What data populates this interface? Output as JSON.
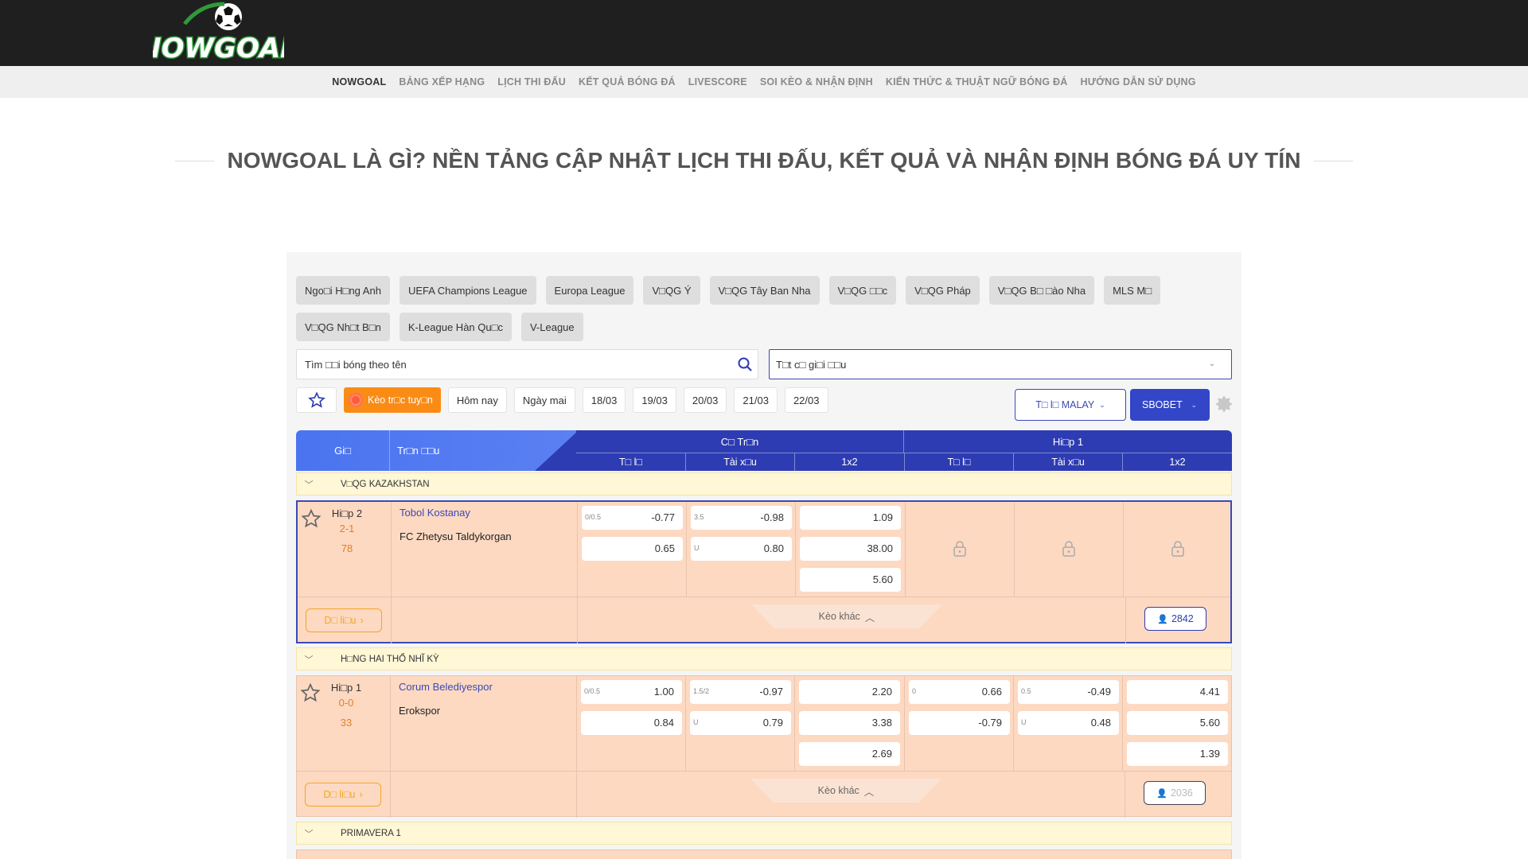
{
  "brand": {
    "logo_text": "NOWGOAL"
  },
  "nav": {
    "items": [
      "NOWGOAL",
      "BẢNG XẾP HẠNG",
      "LỊCH THI ĐẤU",
      "KẾT QUẢ BÓNG ĐÁ",
      "LIVESCORE",
      "SOI KÈO & NHẬN ĐỊNH",
      "KIẾN THỨC & THUẬT NGỮ BÓNG ĐÁ",
      "HƯỚNG DẪN SỬ DỤNG"
    ],
    "active_index": 0
  },
  "page_title": "NOWGOAL LÀ GÌ? NỀN TẢNG CẬP NHẬT LỊCH THI ĐẤU, KẾT QUẢ VÀ NHẬN ĐỊNH BÓNG ĐÁ UY TÍN",
  "leagues_chips": {
    "row1": [
      "Ngo□i H□ng Anh",
      "UEFA Champions League",
      "Europa League",
      "V□QG Ý",
      "V□QG Tây Ban Nha",
      "V□QG □□c",
      "V□QG Pháp",
      "V□QG B□ □ào Nha",
      "MLS M□"
    ],
    "row2": [
      "V□QG Nh□t B□n",
      "K-League Hàn Qu□c",
      "V-League"
    ]
  },
  "search": {
    "placeholder": "Tìm □□i bóng theo tên"
  },
  "league_select": {
    "value": "T□t c□ gi□i □□u"
  },
  "filters": {
    "live_label": "Kèo tr□c tuy□n",
    "today": "Hôm nay",
    "tomorrow": "Ngày mai",
    "dates": [
      "18/03",
      "19/03",
      "20/03",
      "21/03",
      "22/03"
    ]
  },
  "odds_type": "T□ l□ MALAY",
  "bookmaker": "SBOBET",
  "table_header": {
    "time": "Gi□",
    "match": "Tr□n □□u",
    "full_match": "C□ Tr□n",
    "first_half": "Hi□p 1",
    "sub": [
      "T□ l□",
      "Tài x□u",
      "1x2",
      "T□ l□",
      "Tài x□u",
      "1x2"
    ]
  },
  "leagues": [
    {
      "name": "V□QG KAZAKHSTAN",
      "match": {
        "period": "Hi□p 2",
        "score": "2-1",
        "minute": "78",
        "home": "Tobol Kostanay",
        "away": "FC Zhetysu Taldykorgan",
        "ft_handicap": {
          "line": "0/0.5",
          "home": "-0.77",
          "away": "0.65"
        },
        "ft_ou": {
          "line": "3.5",
          "over": "-0.98",
          "under_label": "U",
          "under": "0.80"
        },
        "ft_1x2": [
          "1.09",
          "38.00",
          "5.60"
        ],
        "h1_locked": true,
        "data_label": "D□ li□u",
        "more_label": "Kèo khác",
        "viewers": "2842"
      }
    },
    {
      "name": "H□NG HAI THỔ NHĨ KỲ",
      "match": {
        "period": "Hi□p 1",
        "score": "0-0",
        "minute": "33",
        "home": "Corum Belediyespor",
        "away": "Erokspor",
        "ft_handicap": {
          "line": "0/0.5",
          "home": "1.00",
          "away": "0.84"
        },
        "ft_ou": {
          "line": "1.5/2",
          "over": "-0.97",
          "under_label": "U",
          "under": "0.79"
        },
        "ft_1x2": [
          "2.20",
          "3.38",
          "2.69"
        ],
        "h1_handicap": {
          "line": "0",
          "home": "0.66",
          "away": "-0.79"
        },
        "h1_ou": {
          "line": "0.5",
          "over": "-0.49",
          "under_label": "U",
          "under": "0.48"
        },
        "h1_1x2": [
          "4.41",
          "5.60",
          "1.39"
        ],
        "data_label": "D□ li□u",
        "more_label": "Kèo khác",
        "viewers": "2036"
      }
    },
    {
      "name": "PRIMAVERA 1"
    }
  ]
}
